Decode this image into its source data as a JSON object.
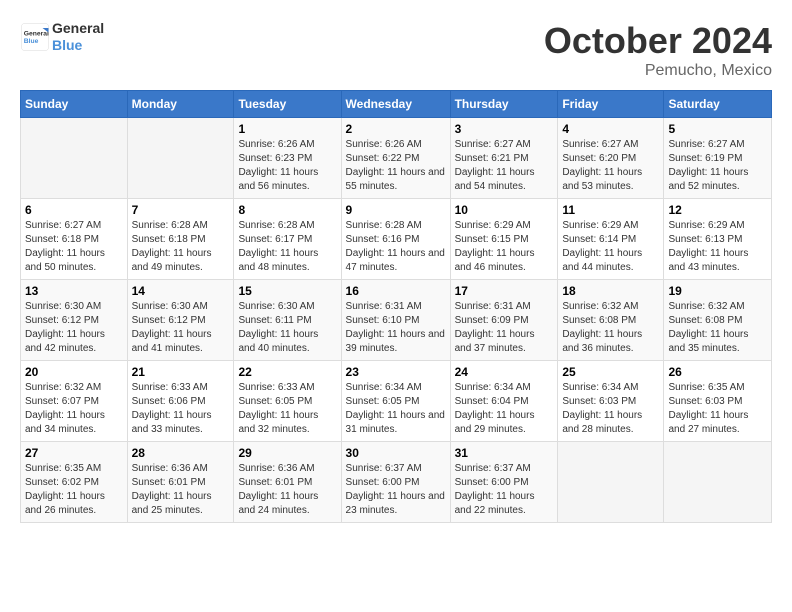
{
  "header": {
    "logo_line1": "General",
    "logo_line2": "Blue",
    "month": "October 2024",
    "location": "Pemucho, Mexico"
  },
  "weekdays": [
    "Sunday",
    "Monday",
    "Tuesday",
    "Wednesday",
    "Thursday",
    "Friday",
    "Saturday"
  ],
  "weeks": [
    [
      {
        "day": "",
        "sunrise": "",
        "sunset": "",
        "daylight": ""
      },
      {
        "day": "",
        "sunrise": "",
        "sunset": "",
        "daylight": ""
      },
      {
        "day": "1",
        "sunrise": "Sunrise: 6:26 AM",
        "sunset": "Sunset: 6:23 PM",
        "daylight": "Daylight: 11 hours and 56 minutes."
      },
      {
        "day": "2",
        "sunrise": "Sunrise: 6:26 AM",
        "sunset": "Sunset: 6:22 PM",
        "daylight": "Daylight: 11 hours and 55 minutes."
      },
      {
        "day": "3",
        "sunrise": "Sunrise: 6:27 AM",
        "sunset": "Sunset: 6:21 PM",
        "daylight": "Daylight: 11 hours and 54 minutes."
      },
      {
        "day": "4",
        "sunrise": "Sunrise: 6:27 AM",
        "sunset": "Sunset: 6:20 PM",
        "daylight": "Daylight: 11 hours and 53 minutes."
      },
      {
        "day": "5",
        "sunrise": "Sunrise: 6:27 AM",
        "sunset": "Sunset: 6:19 PM",
        "daylight": "Daylight: 11 hours and 52 minutes."
      }
    ],
    [
      {
        "day": "6",
        "sunrise": "Sunrise: 6:27 AM",
        "sunset": "Sunset: 6:18 PM",
        "daylight": "Daylight: 11 hours and 50 minutes."
      },
      {
        "day": "7",
        "sunrise": "Sunrise: 6:28 AM",
        "sunset": "Sunset: 6:18 PM",
        "daylight": "Daylight: 11 hours and 49 minutes."
      },
      {
        "day": "8",
        "sunrise": "Sunrise: 6:28 AM",
        "sunset": "Sunset: 6:17 PM",
        "daylight": "Daylight: 11 hours and 48 minutes."
      },
      {
        "day": "9",
        "sunrise": "Sunrise: 6:28 AM",
        "sunset": "Sunset: 6:16 PM",
        "daylight": "Daylight: 11 hours and 47 minutes."
      },
      {
        "day": "10",
        "sunrise": "Sunrise: 6:29 AM",
        "sunset": "Sunset: 6:15 PM",
        "daylight": "Daylight: 11 hours and 46 minutes."
      },
      {
        "day": "11",
        "sunrise": "Sunrise: 6:29 AM",
        "sunset": "Sunset: 6:14 PM",
        "daylight": "Daylight: 11 hours and 44 minutes."
      },
      {
        "day": "12",
        "sunrise": "Sunrise: 6:29 AM",
        "sunset": "Sunset: 6:13 PM",
        "daylight": "Daylight: 11 hours and 43 minutes."
      }
    ],
    [
      {
        "day": "13",
        "sunrise": "Sunrise: 6:30 AM",
        "sunset": "Sunset: 6:12 PM",
        "daylight": "Daylight: 11 hours and 42 minutes."
      },
      {
        "day": "14",
        "sunrise": "Sunrise: 6:30 AM",
        "sunset": "Sunset: 6:12 PM",
        "daylight": "Daylight: 11 hours and 41 minutes."
      },
      {
        "day": "15",
        "sunrise": "Sunrise: 6:30 AM",
        "sunset": "Sunset: 6:11 PM",
        "daylight": "Daylight: 11 hours and 40 minutes."
      },
      {
        "day": "16",
        "sunrise": "Sunrise: 6:31 AM",
        "sunset": "Sunset: 6:10 PM",
        "daylight": "Daylight: 11 hours and 39 minutes."
      },
      {
        "day": "17",
        "sunrise": "Sunrise: 6:31 AM",
        "sunset": "Sunset: 6:09 PM",
        "daylight": "Daylight: 11 hours and 37 minutes."
      },
      {
        "day": "18",
        "sunrise": "Sunrise: 6:32 AM",
        "sunset": "Sunset: 6:08 PM",
        "daylight": "Daylight: 11 hours and 36 minutes."
      },
      {
        "day": "19",
        "sunrise": "Sunrise: 6:32 AM",
        "sunset": "Sunset: 6:08 PM",
        "daylight": "Daylight: 11 hours and 35 minutes."
      }
    ],
    [
      {
        "day": "20",
        "sunrise": "Sunrise: 6:32 AM",
        "sunset": "Sunset: 6:07 PM",
        "daylight": "Daylight: 11 hours and 34 minutes."
      },
      {
        "day": "21",
        "sunrise": "Sunrise: 6:33 AM",
        "sunset": "Sunset: 6:06 PM",
        "daylight": "Daylight: 11 hours and 33 minutes."
      },
      {
        "day": "22",
        "sunrise": "Sunrise: 6:33 AM",
        "sunset": "Sunset: 6:05 PM",
        "daylight": "Daylight: 11 hours and 32 minutes."
      },
      {
        "day": "23",
        "sunrise": "Sunrise: 6:34 AM",
        "sunset": "Sunset: 6:05 PM",
        "daylight": "Daylight: 11 hours and 31 minutes."
      },
      {
        "day": "24",
        "sunrise": "Sunrise: 6:34 AM",
        "sunset": "Sunset: 6:04 PM",
        "daylight": "Daylight: 11 hours and 29 minutes."
      },
      {
        "day": "25",
        "sunrise": "Sunrise: 6:34 AM",
        "sunset": "Sunset: 6:03 PM",
        "daylight": "Daylight: 11 hours and 28 minutes."
      },
      {
        "day": "26",
        "sunrise": "Sunrise: 6:35 AM",
        "sunset": "Sunset: 6:03 PM",
        "daylight": "Daylight: 11 hours and 27 minutes."
      }
    ],
    [
      {
        "day": "27",
        "sunrise": "Sunrise: 6:35 AM",
        "sunset": "Sunset: 6:02 PM",
        "daylight": "Daylight: 11 hours and 26 minutes."
      },
      {
        "day": "28",
        "sunrise": "Sunrise: 6:36 AM",
        "sunset": "Sunset: 6:01 PM",
        "daylight": "Daylight: 11 hours and 25 minutes."
      },
      {
        "day": "29",
        "sunrise": "Sunrise: 6:36 AM",
        "sunset": "Sunset: 6:01 PM",
        "daylight": "Daylight: 11 hours and 24 minutes."
      },
      {
        "day": "30",
        "sunrise": "Sunrise: 6:37 AM",
        "sunset": "Sunset: 6:00 PM",
        "daylight": "Daylight: 11 hours and 23 minutes."
      },
      {
        "day": "31",
        "sunrise": "Sunrise: 6:37 AM",
        "sunset": "Sunset: 6:00 PM",
        "daylight": "Daylight: 11 hours and 22 minutes."
      },
      {
        "day": "",
        "sunrise": "",
        "sunset": "",
        "daylight": ""
      },
      {
        "day": "",
        "sunrise": "",
        "sunset": "",
        "daylight": ""
      }
    ]
  ]
}
